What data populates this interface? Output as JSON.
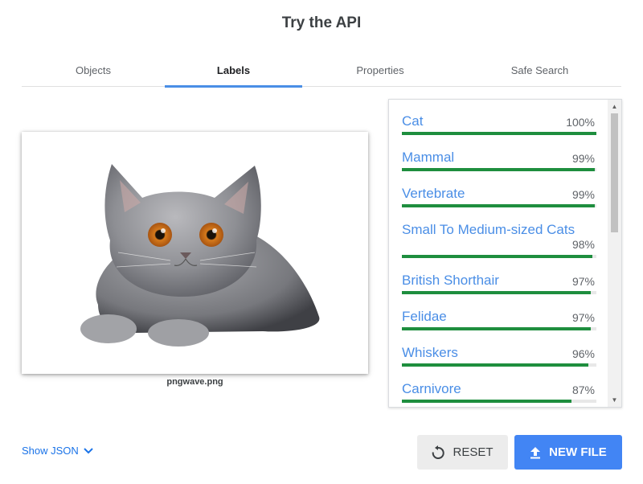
{
  "page_title": "Try the API",
  "tabs": [
    {
      "label": "Objects",
      "active": false
    },
    {
      "label": "Labels",
      "active": true
    },
    {
      "label": "Properties",
      "active": false
    },
    {
      "label": "Safe Search",
      "active": false
    }
  ],
  "image": {
    "filename": "pngwave.png",
    "subject_icon": "cat-photo"
  },
  "labels": [
    {
      "name": "Cat",
      "percent": "100%",
      "score": 1.0
    },
    {
      "name": "Mammal",
      "percent": "99%",
      "score": 0.99
    },
    {
      "name": "Vertebrate",
      "percent": "99%",
      "score": 0.99
    },
    {
      "name": "Small To Medium-sized Cats",
      "percent": "98%",
      "score": 0.98
    },
    {
      "name": "British Shorthair",
      "percent": "97%",
      "score": 0.97
    },
    {
      "name": "Felidae",
      "percent": "97%",
      "score": 0.97
    },
    {
      "name": "Whiskers",
      "percent": "96%",
      "score": 0.96
    },
    {
      "name": "Carnivore",
      "percent": "87%",
      "score": 0.87
    }
  ],
  "footer": {
    "show_json_label": "Show JSON",
    "reset_label": "RESET",
    "new_file_label": "NEW FILE"
  },
  "colors": {
    "accent_blue": "#4285f4",
    "label_blue": "#4a8ee6",
    "bar_green": "#1e8e3e"
  }
}
